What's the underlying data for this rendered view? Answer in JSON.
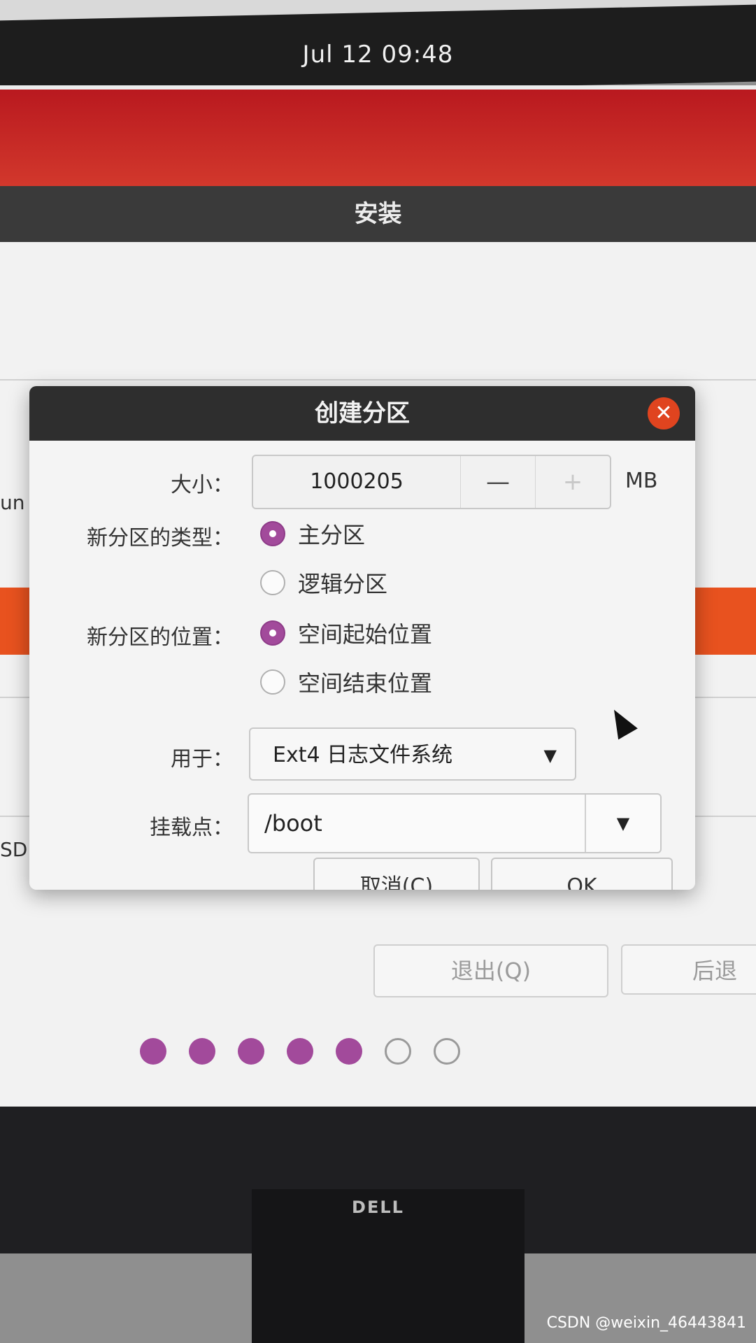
{
  "top_bar": {
    "clock": "Jul 12  09:48"
  },
  "window": {
    "title": "安装"
  },
  "background": {
    "left_peek_1": "un",
    "left_peek_2": "SD",
    "quit_button": "退出(Q)",
    "back_button": "后退",
    "progress_dots": {
      "filled": 5,
      "total": 7,
      "accent": "#a24a9b"
    }
  },
  "dialog": {
    "title": "创建分区",
    "close_icon": "close-icon",
    "size": {
      "label": "大小：",
      "value": "1000205",
      "decrement": "—",
      "increment": "+",
      "unit": "MB"
    },
    "type": {
      "label": "新分区的类型：",
      "options": [
        "主分区",
        "逻辑分区"
      ],
      "selected": 0
    },
    "location": {
      "label": "新分区的位置：",
      "options": [
        "空间起始位置",
        "空间结束位置"
      ],
      "selected": 0
    },
    "use_as": {
      "label": "用于：",
      "value": "Ext4 日志文件系统"
    },
    "mount": {
      "label": "挂载点：",
      "value": "/boot"
    },
    "cancel_button": "取消(C)",
    "ok_button": "OK"
  },
  "monitor": {
    "brand": "DELL"
  },
  "watermark": "CSDN @weixin_46443841",
  "colors": {
    "titlebar": "#2e2e2e",
    "accent": "#a24a9b",
    "close": "#e0441f",
    "installer_red": "#c8281f",
    "orange": "#e8521f"
  }
}
